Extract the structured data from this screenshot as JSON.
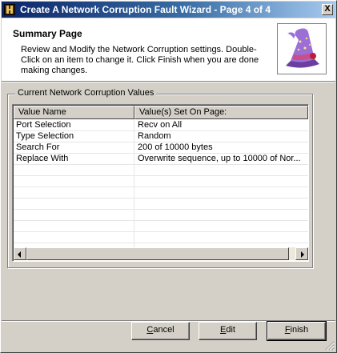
{
  "window": {
    "title": "Create A Network Corruption Fault Wizard - Page 4 of 4",
    "close_label": "X"
  },
  "header": {
    "title": "Summary Page",
    "description": "Review and Modify the Network Corruption settings. Double-Click on an item to change it.  Click Finish when you are done making changes.",
    "image_icon": "wizard-hat-icon"
  },
  "group": {
    "legend": "Current Network Corruption Values"
  },
  "list": {
    "columns": [
      "Value Name",
      "Value(s) Set On Page:"
    ],
    "rows": [
      {
        "name": "Port Selection",
        "value": "Recv on All"
      },
      {
        "name": "Type Selection",
        "value": "Random"
      },
      {
        "name": "Search For",
        "value": "200 of 10000 bytes"
      },
      {
        "name": "Replace With",
        "value": "Overwrite sequence, up to 10000 of Nor..."
      }
    ]
  },
  "buttons": {
    "cancel": {
      "label": "Cancel",
      "accel": "C",
      "rest": "ancel"
    },
    "edit": {
      "label": "Edit",
      "accel": "E",
      "rest": "dit"
    },
    "finish": {
      "label": "Finish",
      "accel": "F",
      "rest": "inish"
    }
  },
  "colors": {
    "titlebar_start": "#0a246a",
    "titlebar_end": "#a6caf0",
    "face": "#d4d0c8"
  }
}
